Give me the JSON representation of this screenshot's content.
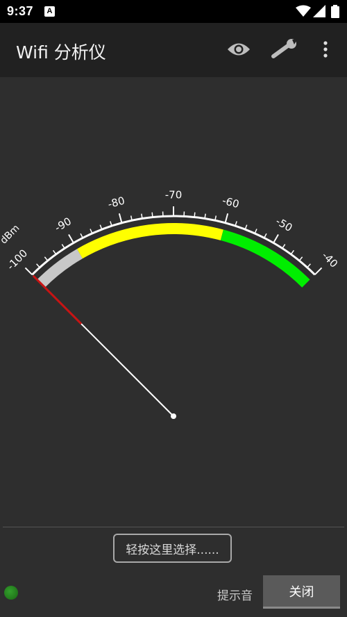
{
  "status_bar": {
    "time": "9:37",
    "notification_badge": "A",
    "icons": [
      "wifi-icon",
      "cell-signal-icon",
      "battery-icon"
    ]
  },
  "app_bar": {
    "title": "Wifi 分析仪",
    "actions": [
      "eye-icon",
      "wrench-icon",
      "more-vert-icon"
    ]
  },
  "gauge": {
    "unit": "dBm",
    "tick_labels": [
      "-100",
      "-90",
      "-80",
      "-70",
      "-60",
      "-50",
      "-40"
    ],
    "min": -100,
    "max": -40,
    "needle_value": -100,
    "bands": [
      {
        "from": -100,
        "to": -90,
        "color": "#c8c8c8"
      },
      {
        "from": -90,
        "to": -60,
        "color": "#ffff00"
      },
      {
        "from": -60,
        "to": -40,
        "color": "#00ee00"
      }
    ],
    "needle_color": "#ffffff",
    "needle_tip_color": "#c81414"
  },
  "footer": {
    "select_label": "轻按这里选择......",
    "sound_label": "提示音",
    "close_label": "关闭",
    "led_color": "#2e8b2e"
  }
}
